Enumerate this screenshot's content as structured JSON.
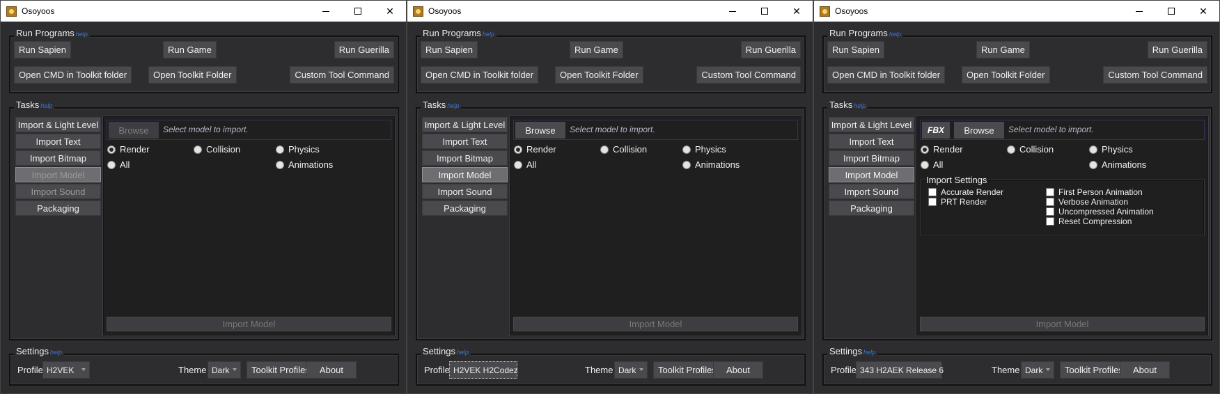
{
  "windows": [
    {
      "title": "Osoyoos",
      "run_programs": {
        "title": "Run Programs",
        "help": "help",
        "buttons": [
          "Run Sapien",
          "Run Game",
          "Run Guerilla",
          "Open CMD in Toolkit folder",
          "Open Toolkit Folder",
          "Custom Tool Command"
        ]
      },
      "tasks": {
        "title": "Tasks",
        "help": "help",
        "nav": [
          "Import & Light Level",
          "Import Text",
          "Import Bitmap",
          "Import Model",
          "Import Sound",
          "Packaging"
        ],
        "selected": "Import Model",
        "disabled": [
          "Import Sound"
        ],
        "browse_label": "Browse",
        "browse_enabled": false,
        "path_placeholder": "Select model to import.",
        "radios": [
          "Render",
          "Collision",
          "Physics",
          "All",
          "Animations"
        ],
        "checked_radio": "Render",
        "action_label": "Import Model"
      },
      "settings": {
        "title": "Settings",
        "help": "help",
        "profile_label": "Profile",
        "profile_value": "H2VEK",
        "theme_label": "Theme",
        "theme_value": "Dark",
        "toolkit_profiles": "Toolkit Profiles",
        "about": "About"
      }
    },
    {
      "title": "Osoyoos",
      "run_programs": {
        "title": "Run Programs",
        "help": "help",
        "buttons": [
          "Run Sapien",
          "Run Game",
          "Run Guerilla",
          "Open CMD in Toolkit folder",
          "Open Toolkit Folder",
          "Custom Tool Command"
        ]
      },
      "tasks": {
        "title": "Tasks",
        "help": "help",
        "nav": [
          "Import & Light Level",
          "Import Text",
          "Import Bitmap",
          "Import Model",
          "Import Sound",
          "Packaging"
        ],
        "selected": "Import Model",
        "browse_label": "Browse",
        "browse_enabled": true,
        "path_placeholder": "Select model to import.",
        "radios": [
          "Render",
          "Collision",
          "Physics",
          "All",
          "Animations"
        ],
        "checked_radio": "Render",
        "action_label": "Import Model"
      },
      "settings": {
        "title": "Settings",
        "help": "help",
        "profile_label": "Profile",
        "profile_value": "H2VEK H2Codez",
        "theme_label": "Theme",
        "theme_value": "Dark",
        "toolkit_profiles": "Toolkit Profiles",
        "about": "About"
      }
    },
    {
      "title": "Osoyoos",
      "run_programs": {
        "title": "Run Programs",
        "help": "help",
        "buttons": [
          "Run Sapien",
          "Run Game",
          "Run Guerilla",
          "Open CMD in Toolkit folder",
          "Open Toolkit Folder",
          "Custom Tool Command"
        ]
      },
      "tasks": {
        "title": "Tasks",
        "help": "help",
        "nav": [
          "Import & Light Level",
          "Import Text",
          "Import Bitmap",
          "Import Model",
          "Import Sound",
          "Packaging"
        ],
        "selected": "Import Model",
        "fbx_label": "FBX",
        "browse_label": "Browse",
        "browse_enabled": true,
        "path_placeholder": "Select model to import.",
        "radios": [
          "Render",
          "Collision",
          "Physics",
          "All",
          "Animations"
        ],
        "checked_radio": "Render",
        "import_settings": {
          "title": "Import Settings",
          "left": [
            "Accurate Render",
            "PRT Render"
          ],
          "right": [
            "First Person Animation",
            "Verbose Animation",
            "Uncompressed Animation",
            "Reset Compression"
          ]
        },
        "action_label": "Import Model"
      },
      "settings": {
        "title": "Settings",
        "help": "help",
        "profile_label": "Profile",
        "profile_value": "343 H2AEK Release 6",
        "theme_label": "Theme",
        "theme_value": "Dark",
        "toolkit_profiles": "Toolkit Profiles",
        "about": "About"
      }
    }
  ]
}
